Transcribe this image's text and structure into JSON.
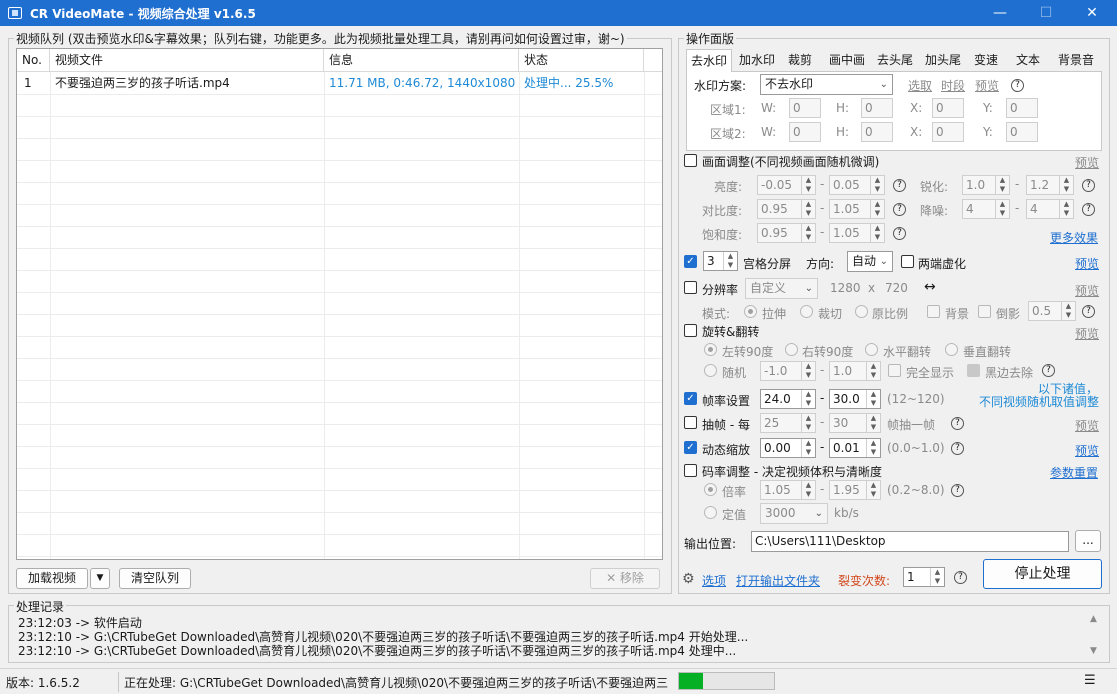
{
  "window": {
    "title": "CR VideoMate - 视频综合处理 v1.6.5",
    "minimize": "—",
    "maximize": "☐",
    "close": "✕"
  },
  "queue": {
    "group_title": "视频队列 (双击预览水印&字幕效果；队列右键，功能更多。此为视频批量处理工具，请别再问如何设置过审，谢~)",
    "columns": [
      "No.",
      "视频文件",
      "信息",
      "状态"
    ],
    "rows": [
      {
        "no": "1",
        "file": "不要强迫两三岁的孩子听话.mp4",
        "info": "11.71 MB, 0:46.72, 1440x1080",
        "status": "处理中... 25.5%"
      }
    ],
    "load_button": "加载视频",
    "dropdown_arrow": "▼",
    "clear_button": "清空队列",
    "remove_button": "✕ 移除"
  },
  "panel": {
    "group_title": "操作面版",
    "tabs": [
      "去水印",
      "加水印",
      "裁剪",
      "画中画",
      "去头尾",
      "加头尾",
      "变速",
      "文本",
      "背景音"
    ],
    "watermark": {
      "scheme_label": "水印方案:",
      "scheme_value": "不去水印",
      "select_link": "选取",
      "time_link": "时段",
      "preview_link": "预览",
      "region1": "区域1:",
      "region2": "区域2:",
      "w": "W:",
      "h": "H:",
      "x": "X:",
      "y": "Y:",
      "zero": "0"
    },
    "picture": {
      "label": "画面调整(不同视频画面随机微调)",
      "preview": "预览",
      "brightness": "亮度:",
      "b_min": "-0.05",
      "b_max": "0.05",
      "sharpen": "锐化:",
      "s_min": "1.0",
      "s_max": "1.2",
      "contrast": "对比度:",
      "c_min": "0.95",
      "c_max": "1.05",
      "denoise": "降噪:",
      "d_min": "4",
      "d_max": "4",
      "saturation": "饱和度:",
      "sa_min": "0.95",
      "sa_max": "1.05",
      "more": "更多效果",
      "dash": "-"
    },
    "grid": {
      "count": "3",
      "label": "宫格分屏",
      "dir_label": "方向:",
      "dir_value": "自动",
      "blur_label": "两端虚化",
      "preview": "预览"
    },
    "resolution": {
      "label": "分辨率",
      "preset": "自定义",
      "w": "1280",
      "x": "x",
      "h": "720",
      "swap": "↔",
      "preview": "预览",
      "mode_label": "模式:",
      "stretch": "拉伸",
      "crop": "裁切",
      "keep": "原比例",
      "bg": "背景",
      "shadow": "倒影",
      "shadow_val": "0.5"
    },
    "rotate": {
      "label": "旋转&翻转",
      "preview": "预览",
      "left90": "左转90度",
      "right90": "右转90度",
      "hflip": "水平翻转",
      "vflip": "垂直翻转",
      "random": "随机",
      "r_min": "-1.0",
      "r_max": "1.0",
      "full": "完全显示",
      "black": "黑边去除"
    },
    "note": {
      "line1": "以下诸值，",
      "line2": "不同视频随机取值调整"
    },
    "fps": {
      "label": "帧率设置",
      "min": "24.0",
      "max": "30.0",
      "range": "(12~120)"
    },
    "drop": {
      "label": "抽帧 - 每",
      "min": "25",
      "max": "30",
      "suffix": "帧抽一帧",
      "preview": "预览"
    },
    "zoom": {
      "label": "动态缩放",
      "min": "0.00",
      "max": "0.01",
      "range": "(0.0~1.0)",
      "preview": "预览"
    },
    "bitrate": {
      "label": "码率调整 - 决定视频体积与清晰度",
      "reset": "参数重置",
      "ratio": "倍率",
      "r_min": "1.05",
      "r_max": "1.95",
      "range": "(0.2~8.0)",
      "fixed": "定值",
      "fixed_val": "3000",
      "unit": "kb/s"
    },
    "output": {
      "label": "输出位置:",
      "path": "C:\\Users\\111\\Desktop",
      "browse": "..."
    },
    "options_link": "选项",
    "open_folder_link": "打开输出文件夹",
    "fission_label": "裂变次数:",
    "fission_value": "1",
    "stop_button": "停止处理"
  },
  "log": {
    "group_title": "处理记录",
    "lines": [
      "23:12:03 -> 软件启动",
      "23:12:10 -> G:\\CRTubeGet Downloaded\\高赞育儿视频\\020\\不要强迫两三岁的孩子听话\\不要强迫两三岁的孩子听话.mp4 开始处理...",
      "23:12:10 -> G:\\CRTubeGet Downloaded\\高赞育儿视频\\020\\不要强迫两三岁的孩子听话\\不要强迫两三岁的孩子听话.mp4 处理中..."
    ]
  },
  "status": {
    "version": "版本: 1.6.5.2",
    "processing": "正在处理: G:\\CRTubeGet Downloaded\\高赞育儿视频\\020\\不要强迫两三岁的孩子听话\\不要强迫两三",
    "progress": 0.255,
    "menu_icon": "☰"
  },
  "colors": {
    "accent": "#1e6fd0",
    "progress": "#06b025",
    "link": "#1e6fd0"
  }
}
